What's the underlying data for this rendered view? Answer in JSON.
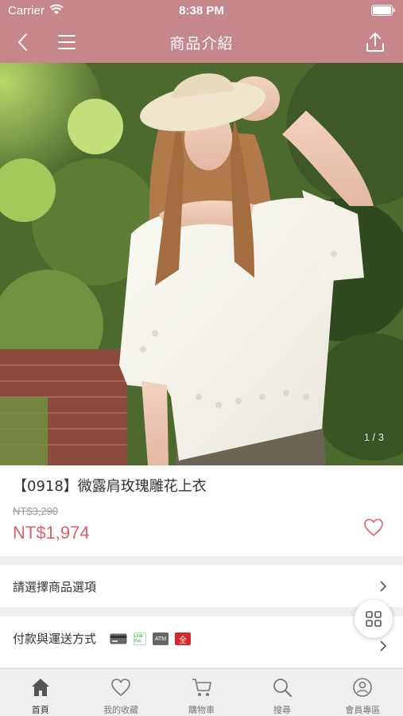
{
  "status_bar": {
    "carrier": "Carrier",
    "time": "8:38 PM"
  },
  "nav": {
    "title": "商品介紹",
    "back_icon": "back-arrow-icon",
    "menu_icon": "hamburger-menu-icon",
    "share_icon": "share-icon"
  },
  "gallery": {
    "pager": "1 / 3"
  },
  "product": {
    "name": "【0918】微露肩玫瑰雕花上衣",
    "original_price": "NT$3,290",
    "price": "NT$1,974"
  },
  "options": {
    "select_label": "請選擇商品選項"
  },
  "payment": {
    "label": "付款與運送方式",
    "icons": [
      "card",
      "LINE Pay",
      "ATM",
      "store"
    ],
    "line_pay_text": "LINE Pay",
    "atm_text": "ATM",
    "store_text": "全"
  },
  "tabs": [
    {
      "label": "首頁",
      "icon": "home-icon",
      "active": true
    },
    {
      "label": "我的收藏",
      "icon": "heart-icon",
      "active": false
    },
    {
      "label": "購物車",
      "icon": "cart-icon",
      "active": false
    },
    {
      "label": "搜尋",
      "icon": "search-icon",
      "active": false
    },
    {
      "label": "會員專區",
      "icon": "user-icon",
      "active": false
    }
  ],
  "colors": {
    "nav_bg": "#c5868c",
    "price": "#e0606d",
    "tab_bg": "#efefef"
  }
}
